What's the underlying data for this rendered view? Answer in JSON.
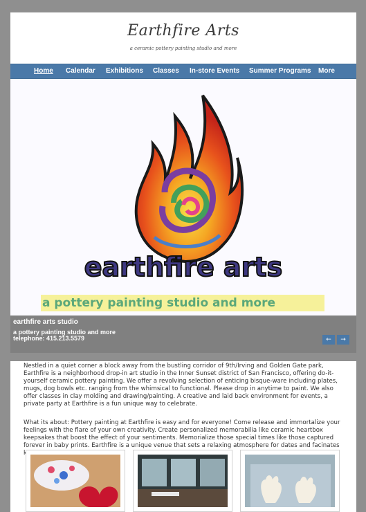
{
  "site": {
    "logo_title": "Earthfire Arts",
    "logo_tagline": "a ceramic pottery painting studio and more"
  },
  "nav": {
    "items": [
      {
        "label": "Home",
        "active": true
      },
      {
        "label": "Calendar",
        "active": false
      },
      {
        "label": "Exhibitions",
        "active": false
      },
      {
        "label": "Classes",
        "active": false
      },
      {
        "label": "In-store Events",
        "active": false
      },
      {
        "label": "Summer Programs",
        "active": false
      },
      {
        "label": "More",
        "active": false
      }
    ]
  },
  "hero": {
    "brand": "earthfire arts",
    "tagline": "a pottery painting studio and more",
    "caption_title": "earthfire arts studio",
    "caption_line1": "a pottery painting studio and more",
    "caption_line2": "telephone: 415.213.5579",
    "prev_label": "←",
    "next_label": "→"
  },
  "content": {
    "paragraph1": "Nestled in a quiet corner a block away from the bustling corridor of 9th/Irving and Golden Gate park, Earthfire is a neighborhood drop-in art studio in the Inner Sunset district of San Francisco, offering do-it-yourself ceramic pottery painting. We offer a revolving selection of enticing bisque-ware including plates, mugs, dog bowls etc. ranging from the whimsical to functional. Please drop in anytime to paint. We also offer classes in clay molding and drawing/painting.  A creative and laid back environment for events, a private party at Earthfire is a fun unique way to celebrate.",
    "paragraph2": "What its about: Pottery painting at Earthfire is easy and for everyone! Come release and immortalize your feelings with the flare of your own creativity. Create personalized memorabilia like ceramic heartbox keepsakes that boost the effect of your sentiments. Memorialize those special times like those captured forever in baby prints. Earthfire is a unique venue that sets a relaxing atmosphere for dates and facinates kids."
  },
  "colors": {
    "nav_bg": "#4a79a8",
    "page_bg": "#8f8f8f",
    "brand_purple": "#3e3882",
    "tagline_green": "#5ba87a",
    "tagline_highlight": "#f6f19a"
  }
}
